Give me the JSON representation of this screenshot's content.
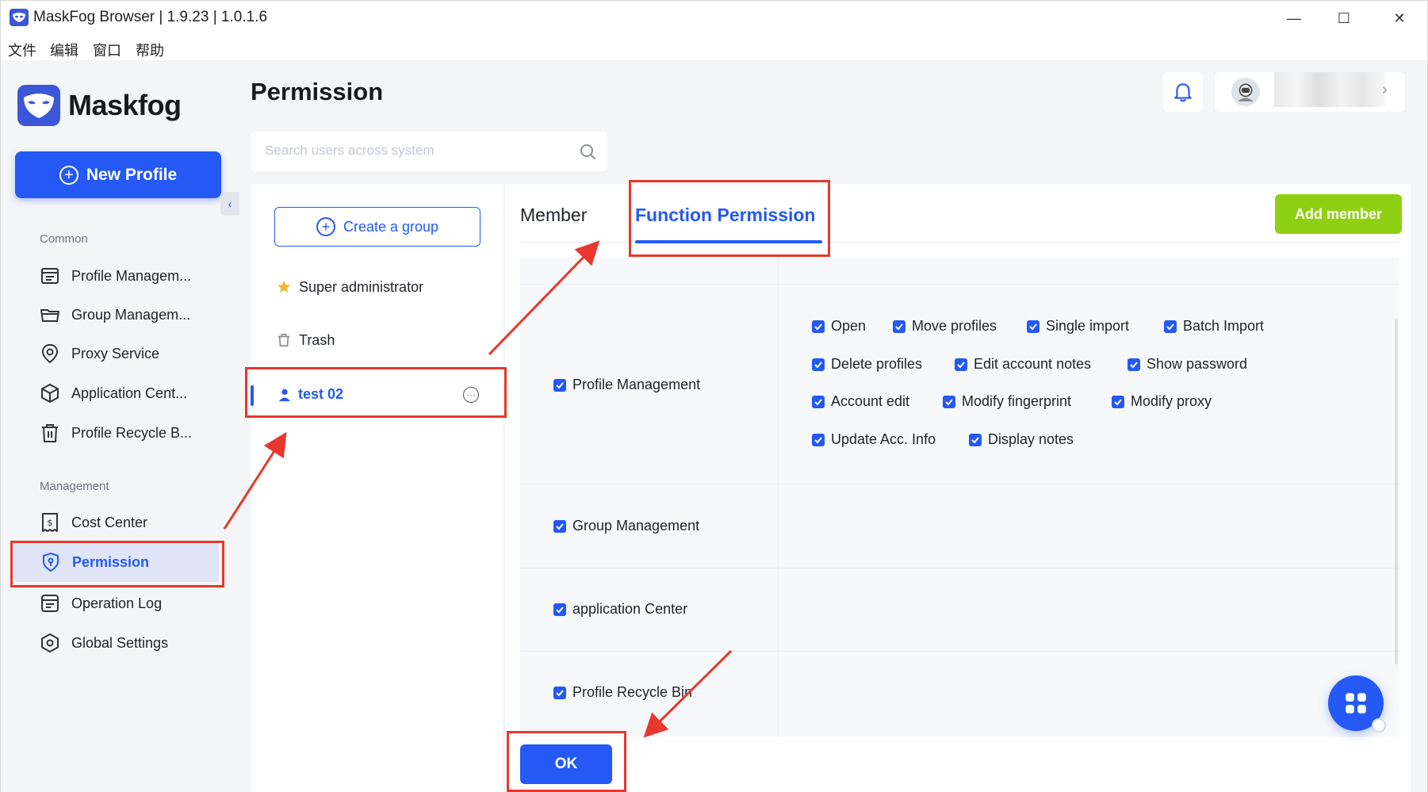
{
  "window": {
    "title": "MaskFog Browser | 1.9.23 | 1.0.1.6",
    "minimize_glyph": "—",
    "maximize_glyph": "☐",
    "close_glyph": "✕"
  },
  "menu": {
    "items": [
      "文件",
      "编辑",
      "窗口",
      "帮助"
    ]
  },
  "sidebar": {
    "logo_text": "Maskfog",
    "new_profile_label": "New Profile",
    "collapse_glyph": "‹",
    "section_common": "Common",
    "common_items": [
      {
        "label": "Profile Managem...",
        "icon": "profile-list-icon"
      },
      {
        "label": "Group Managem...",
        "icon": "folder-icon"
      },
      {
        "label": "Proxy Service",
        "icon": "location-pin-icon"
      },
      {
        "label": "Application Cent...",
        "icon": "hexagon-box-icon"
      },
      {
        "label": "Profile Recycle B...",
        "icon": "trash-icon"
      }
    ],
    "section_management": "Management",
    "management_items": [
      {
        "label": "Cost Center",
        "icon": "dollar-receipt-icon"
      },
      {
        "label": "Permission",
        "icon": "shield-key-icon",
        "active": true
      },
      {
        "label": "Operation Log",
        "icon": "log-icon"
      },
      {
        "label": "Global Settings",
        "icon": "settings-hexagon-icon"
      }
    ]
  },
  "header": {
    "page_title": "Permission",
    "search_placeholder": "Search users across system"
  },
  "groups": {
    "create_label": "Create a group",
    "super_admin_label": "Super administrator",
    "trash_label": "Trash",
    "active_group_label": "test 02"
  },
  "tabs": {
    "member": "Member",
    "function_permission": "Function Permission",
    "active": "function_permission"
  },
  "add_member_label": "Add member",
  "permissions": [
    {
      "category": "Profile Management",
      "checked": true,
      "rows": [
        [
          "Open",
          "Move profiles",
          "Single import",
          "Batch Import"
        ],
        [
          "Delete profiles",
          "Edit account notes",
          "Show password"
        ],
        [
          "Account edit",
          "Modify fingerprint",
          "Modify proxy"
        ],
        [
          "Update Acc. Info",
          "Display notes"
        ]
      ]
    },
    {
      "category": "Group Management",
      "checked": true,
      "rows": []
    },
    {
      "category": "application Center",
      "checked": true,
      "rows": []
    },
    {
      "category": "Profile Recycle Bin",
      "checked": true,
      "rows": []
    }
  ],
  "ok_label": "OK",
  "colors": {
    "primary": "#2459f5",
    "add_member_green": "#8fd112",
    "annotation_red": "#e8372c",
    "sidebar_bg": "#f4f5f7"
  }
}
